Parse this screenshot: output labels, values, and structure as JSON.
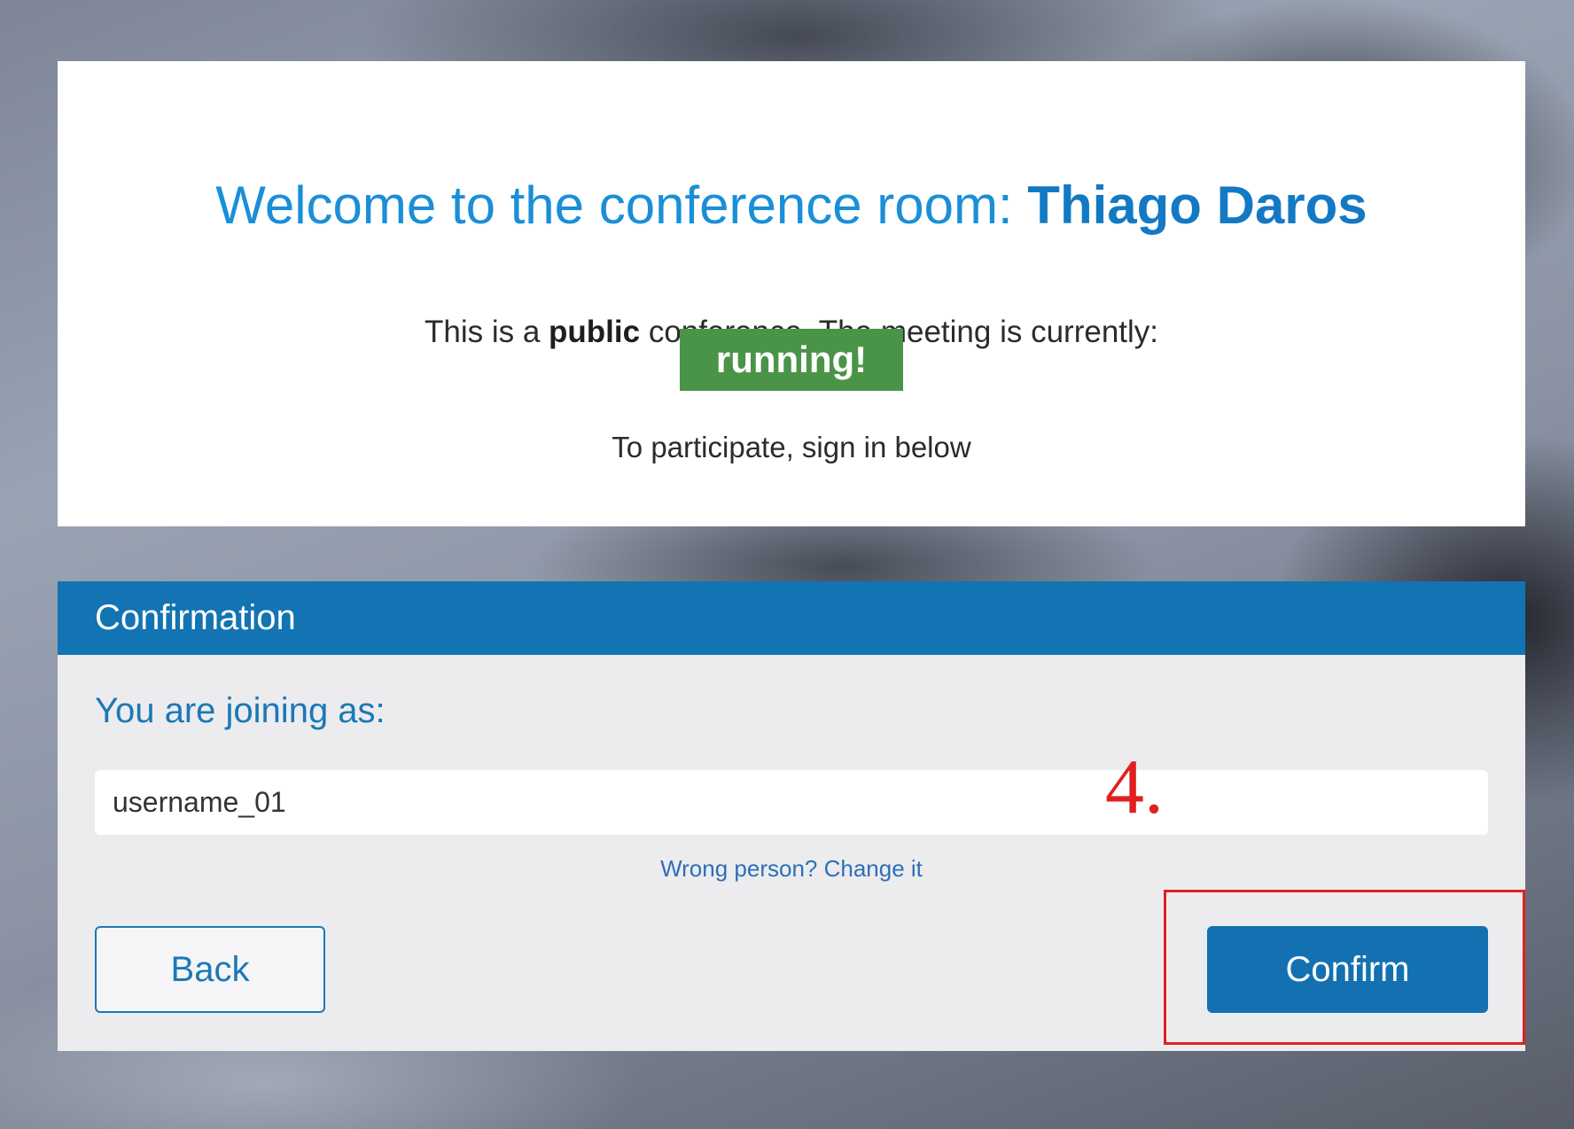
{
  "welcome": {
    "prefix": "Welcome to the conference room: ",
    "room_name": "Thiago Daros"
  },
  "info": {
    "part1": "This is a ",
    "emphasis": "public",
    "part2": " conference. The meeting is currently:"
  },
  "status": {
    "label": "running!",
    "color": "#4a9448"
  },
  "participate_text": "To participate, sign in below",
  "confirmation": {
    "header_title": "Confirmation",
    "joining_label": "You are joining as:",
    "username_value": "username_01",
    "change_link": "Wrong person? Change it",
    "back_label": "Back",
    "confirm_label": "Confirm"
  },
  "annotation": {
    "step_label": "4."
  },
  "colors": {
    "accent": "#1274b3",
    "title_blue": "#1a8fd8",
    "annotation_red": "#e02020"
  }
}
